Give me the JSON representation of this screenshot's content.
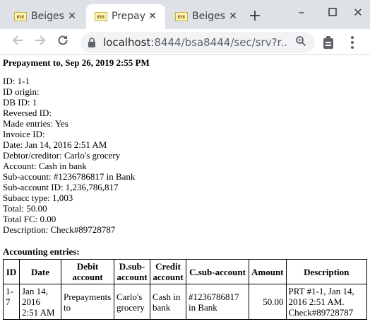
{
  "browser": {
    "tabs": [
      {
        "favicon": "EIS",
        "title": "Beiges"
      },
      {
        "favicon": "EIS",
        "title": "Prepay"
      },
      {
        "favicon": "EIS",
        "title": "Beiges"
      }
    ],
    "url_host": "localhost",
    "url_rest": ":8444/bsa8444/sec/srv?r...",
    "icons": {
      "back": "back-arrow-icon",
      "forward": "forward-arrow-icon",
      "reload": "reload-icon",
      "lock": "lock-icon",
      "zoom": "zoom-icon",
      "extension": "extension-icon",
      "menu": "kebab-menu-icon"
    }
  },
  "page": {
    "heading": "Prepayment to, Sep 26, 2019 2:55 PM",
    "fields": [
      "ID: 1-1",
      "ID origin:",
      "DB ID: 1",
      "Reversed ID:",
      "Made entries: Yes",
      "Invoice ID:",
      "Date: Jan 14, 2016 2:51 AM",
      "Debtor/creditor: Carlo's grocery",
      "Account: Cash in bank",
      "Sub-account: #1236786817 in Bank",
      "Sub-account ID: 1,236,786,817",
      "Subacc type: 1,003",
      "Total: 50.00",
      "Total FC: 0.00",
      "Description: Check#89728787"
    ],
    "entries_heading": "Accounting entries:",
    "table": {
      "headers": [
        "ID",
        "Date",
        "Debit account",
        "D.sub-account",
        "Credit account",
        "C.sub-account",
        "Amount",
        "Description"
      ],
      "rows": [
        [
          "1-7",
          "Jan 14, 2016 2:51 AM",
          "Prepayments to",
          "Carlo's grocery",
          "Cash in bank",
          "#1236786817 in Bank",
          "50.00",
          "PRT #1-1, Jan 14, 2016 2:51 AM. Check#89728787"
        ]
      ]
    }
  }
}
